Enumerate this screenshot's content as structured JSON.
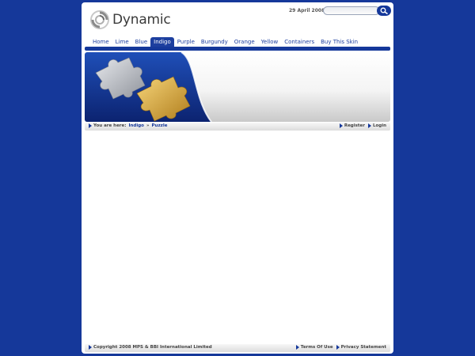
{
  "header": {
    "logo_text": "Dynamic",
    "date": "29 April 2008",
    "search_value": ""
  },
  "nav": {
    "items": [
      "Home",
      "Lime",
      "Blue",
      "Indigo",
      "Purple",
      "Burgundy",
      "Orange",
      "Yellow",
      "Containers",
      "Buy This Skin"
    ],
    "active": "Indigo"
  },
  "breadcrumb": {
    "prefix": "You are here:",
    "path": [
      "Indigo",
      "Puzzle"
    ],
    "separator": "»"
  },
  "account": {
    "register": "Register",
    "login": "Login"
  },
  "footer": {
    "copyright": "Copyright 2008 MPS & BBI International Limited",
    "terms": "Terms Of Use",
    "privacy": "Privacy Statement"
  },
  "colors": {
    "background": "#15389a",
    "accent": "#1d3f9f",
    "puzzle_silver": "#b9bcc2",
    "puzzle_gold": "#d9a93c"
  },
  "icons": {
    "logo": "swirl-logo-icon",
    "search": "magnifier-icon",
    "bullet": "arrow-right-icon"
  }
}
